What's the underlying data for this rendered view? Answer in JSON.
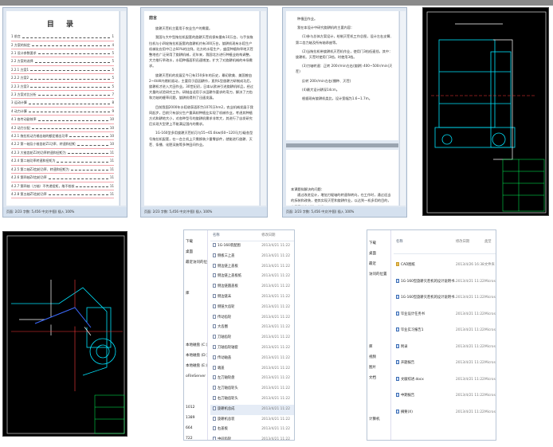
{
  "toc_doc": {
    "title": "目 录",
    "entries": [
      {
        "t": "1 前言",
        "p": "1"
      },
      {
        "t": "2 方案的拟定",
        "p": "4"
      },
      {
        "t": "2.1 设计参数要求",
        "p": "5"
      },
      {
        "t": "2.2 方案的选择",
        "p": "5"
      },
      {
        "t": "2.2.1 方案1",
        "p": "5"
      },
      {
        "t": "2.2.2 方案2",
        "p": "5"
      },
      {
        "t": "2.2.3 方案3",
        "p": "5"
      },
      {
        "t": "2.3 方案对比分析",
        "p": "7"
      },
      {
        "t": "3 运动计算",
        "p": "8"
      },
      {
        "t": "4 动力计算",
        "p": "9"
      },
      {
        "t": "4.1 各传动副效率",
        "p": "10"
      },
      {
        "t": "4.2 动力分配",
        "p": "10"
      },
      {
        "t": "4.2.1 拖拉机动力输出轴的额定输出功率",
        "p": "10"
      },
      {
        "t": "4.2.2 第一轴及小锥齿轮Z1功率、转速和扭矩",
        "p": "10"
      },
      {
        "t": "4.2.3 大锥齿轮Z2的功率转速和扭矩为",
        "p": "11"
      },
      {
        "t": "4.2.4 第二轴功率转速和扭矩为",
        "p": "11"
      },
      {
        "t": "4.2.5 第二轴Z3齿轮功率、转速和扭矩为",
        "p": "11"
      },
      {
        "t": "4.2.6 第四轴Z4齿轮功率",
        "p": "11"
      },
      {
        "t": "4.2.7 第四轴（刀轴）不传递扭矩，故不校核",
        "p": "11"
      },
      {
        "t": "4.2.8 第五轴Z5齿轮功率",
        "p": "11"
      }
    ],
    "status": "页面: 2/23  字数: 5,456  中文(中国)  插入  100%"
  },
  "intro_doc": {
    "heading": "前言",
    "paragraphs": [
      "旋耕灭茬机主要用于农业生产的需要。",
      "我国与大中型拖拉机配套的旋耕灭茬机保有量有10万台，与手扶拖拉机与小四轮拖拉机配套的旋耕机约有300万台，旋耕机现有水稻生产机械化应用中已占60%的比例。北方的水稻生产，盛度种植和旱地灭茬整地也广泛采用了旋耕机械，近年来，我国北方进行种植业结构调整，大力推行旱改水，水稻种植面积迅速增加，扩大了对旋耕机械的市场需求。",
      "旋耕灭茬机的发展至今已有150多年的历史，最初欧美、美国曾由2~4kW内燃机驱动，主要用于庭园耕作，直到L型旋耕刀研制成功后，旋耕机才进入大田作业。30世纪初，日本从欧洲引进旋耕机样品，经过大量的试验研究工作，研制出适用于水田耕作要求的弯刀，解决了刀齿和刀轴的缠草问题，旋耕机得到了迅速发展。",
      "目前我国2000年水稻收获面积为1070万hm2，农业机械发展于我同起步，目前只有部分生产量高较种植业实现了机械作业，考虑其种植方式和耕地大小，对各种型号的旋耕机需求非常大，其进行了自发研究后实现大型更上不能满足国内的需求。",
      "1G-160型多用旋耕灭茬机可与55~65.6kw(60~120马力)级各型号拖拉机配套，在一台主机上只需换装少量零部件，就能进行旋耕、灭茬、条播、化肥深施等多种田间作业。"
    ],
    "status": "页面: 2/23  字数: 5,456  中文(中国)  插入  100%"
  },
  "content_doc": {
    "lines": [
      "种植田作业。",
      "我在本设计中研究旋耕机的主要内容：",
      "(1)参与总体方案设计，绘制灭茬机工作总图，设计左右支臂、第二齿力轴及所有轴承座等。",
      "(2)当拖拉机带旋耕机灭茬机作业，使用门3档低速挡，其中：旋耕机、灭茬时使用门3档，时使用3档。",
      "(3)刀轴转速：正转 200r/min左右(旋耕)   400~500r/min(灭茬)",
      "反转 200r/min左右(播种、灭茬)",
      "(4)最大设计耕深14cm。",
      "根据现有旋耕机类比，设计宽幅为1.6~1.7m。"
    ],
    "page2_heading": "本课题拟解决的问题：",
    "page2_text": "通过改进设计，增加刀辊轴的转速和转向，在工作时，通过适当的拆装和改装，使其实现灭茬和旋耕作业，以达到一机多用的目的，也是要节省材料，节省",
    "status": "页面: 2/23  字数: 5,456  中文(中国)  插入  100%"
  },
  "explorer_dwg": {
    "headers": [
      "名称",
      "修改日期",
      "类型"
    ],
    "nav": [
      "下载",
      "桌面",
      "最近访问的位置",
      "",
      "",
      "库",
      "",
      "",
      "",
      "",
      "本地磁盘 (C:)",
      "本地磁盘 (D:)",
      "本地磁盘 (E:)",
      "oFileServer",
      "",
      "",
      "1012",
      "1389",
      "664",
      "722"
    ],
    "files": [
      {
        "n": "1G-160装配图",
        "d": "2013/4/21 11:22",
        "t": "DWI"
      },
      {
        "n": "侧板三上盖",
        "d": "2013/4/21 11:22",
        "t": "DWI"
      },
      {
        "n": "侧边链上盖板",
        "d": "2013/4/21 11:22",
        "t": "DWI"
      },
      {
        "n": "侧边链上盖板纸",
        "d": "2013/4/21 11:22",
        "t": "DWI"
      },
      {
        "n": "侧边链圆盖板",
        "d": "2013/4/21 11:22",
        "t": "DWI"
      },
      {
        "n": "侧边链末",
        "d": "2013/4/21 11:22",
        "t": "DWI"
      },
      {
        "n": "侧链大齿轮",
        "d": "2013/4/21 11:22",
        "t": "DWI"
      },
      {
        "n": "传动齿轮",
        "d": "2013/4/21 11:22",
        "t": "DWI"
      },
      {
        "n": "大齿圈",
        "d": "2013/4/21 11:22",
        "t": "DWI"
      },
      {
        "n": "刀轴齿轮",
        "d": "2013/4/21 11:22",
        "t": "DWI"
      },
      {
        "n": "刀轴齿轮轴套",
        "d": "2013/4/21 11:22",
        "t": "DWI"
      },
      {
        "n": "传动轴盖",
        "d": "2013/4/21 11:22",
        "t": "DWI"
      },
      {
        "n": "端盖",
        "d": "2013/4/21 11:22",
        "t": "DWI"
      },
      {
        "n": "左刀轴轮盘",
        "d": "2013/4/21 11:22",
        "t": "DWI"
      },
      {
        "n": "左刀轴齿轮头",
        "d": "2013/4/21 11:22",
        "t": "DWI"
      },
      {
        "n": "右刀轴齿轮头",
        "d": "2013/4/21 11:22",
        "t": "DWI"
      },
      {
        "n": "旋耕机总成",
        "d": "2013/4/21 11:22",
        "t": "DWI",
        "selected": true
      },
      {
        "n": "旋耕机总装",
        "d": "2013/4/21 11:22",
        "t": "DWI"
      },
      {
        "n": "右盖板",
        "d": "2013/4/21 11:22",
        "t": "DWI"
      },
      {
        "n": "中间齿轮",
        "d": "2013/4/21 11:22",
        "t": "DWI"
      },
      {
        "n": "中间轴",
        "d": "2013/4/21 11:22",
        "t": "DWI"
      }
    ]
  },
  "explorer_docs": {
    "headers": [
      "名称",
      "修改日期",
      "类型"
    ],
    "nav": [
      "下载",
      "桌面",
      "最近",
      "访问的位置",
      "",
      "",
      "",
      "",
      "",
      "",
      "库",
      "视频",
      "图片",
      "文档",
      "",
      "",
      "",
      "计算机"
    ],
    "files": [
      {
        "n": "CAD图纸",
        "d": "2013/4/26 16:38",
        "t": "文件夹",
        "kind": "folder"
      },
      {
        "n": "1G-160型旋耕灭茬机的设计说明书...",
        "d": "2013/4/21 11:22",
        "t": "Micros",
        "kind": "word"
      },
      {
        "n": "1G-160型旋耕灭茬机的设计说明书...",
        "d": "2013/4/21 11:22",
        "t": "Micros",
        "kind": "word"
      },
      {
        "n": "毕业设计任务书",
        "d": "2013/4/21 11:22",
        "t": "Micros",
        "kind": "word"
      },
      {
        "n": "毕业实习报告1",
        "d": "2013/4/21 11:22",
        "t": "Micros",
        "kind": "word"
      },
      {
        "n": "附录",
        "d": "2013/4/21 11:22",
        "t": "Micros",
        "kind": "word"
      },
      {
        "n": "开题报告",
        "d": "2013/4/21 11:22",
        "t": "Micros",
        "kind": "word"
      },
      {
        "n": "文献综述.docx",
        "d": "2013/4/21 11:22",
        "t": "Micros",
        "kind": "word"
      },
      {
        "n": "中期报告",
        "d": "2013/4/21 11:22",
        "t": "Micros",
        "kind": "word"
      },
      {
        "n": "摘要(X)",
        "d": "2013/4/21 11:22",
        "t": "Micros",
        "kind": "word"
      }
    ]
  },
  "colors": {
    "cad_bg": "#000000",
    "cad_lines": "#00e5ff",
    "cad_accent": "#ff3b3b",
    "word_chrome": "#d5e1ef",
    "selection": "#e5ecf6"
  }
}
